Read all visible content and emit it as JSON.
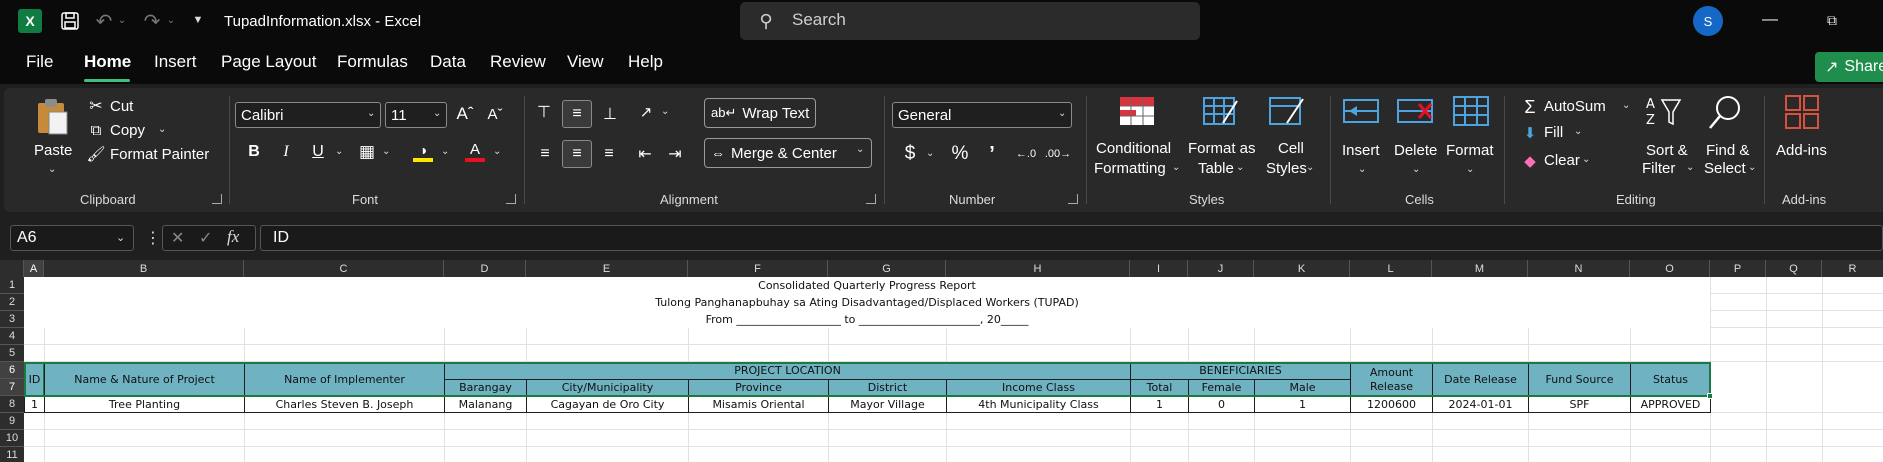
{
  "titlebar": {
    "app_logo": "X",
    "doc_title": "TupadInformation.xlsx  -  Excel",
    "search_placeholder": "Search",
    "avatar_initial": "S",
    "icons": [
      "excel-logo",
      "save-icon",
      "undo-icon",
      "redo-icon",
      "search-icon",
      "minimize-icon",
      "restore-icon"
    ]
  },
  "menu": {
    "tabs": [
      "File",
      "Home",
      "Insert",
      "Page Layout",
      "Formulas",
      "Data",
      "Review",
      "View",
      "Help"
    ],
    "active": "Home",
    "share_label": "Share"
  },
  "ribbon": {
    "clipboard": {
      "paste": "Paste",
      "cut": "Cut",
      "copy": "Copy",
      "format_painter": "Format Painter",
      "label": "Clipboard"
    },
    "font": {
      "name": "Calibri",
      "size": "11",
      "bold": "B",
      "italic": "I",
      "underline": "U",
      "label": "Font"
    },
    "alignment": {
      "wrap_text": "Wrap Text",
      "merge_center": "Merge & Center",
      "label": "Alignment"
    },
    "number": {
      "format": "General",
      "currency": "$",
      "percent": "%",
      "comma": "’",
      "label": "Number"
    },
    "styles": {
      "conditional_formatting_1": "Conditional",
      "conditional_formatting_2": "Formatting",
      "format_as_table_1": "Format as",
      "format_as_table_2": "Table",
      "cell_styles_1": "Cell",
      "cell_styles_2": "Styles",
      "label": "Styles"
    },
    "cells": {
      "insert": "Insert",
      "delete": "Delete",
      "format": "Format",
      "label": "Cells"
    },
    "editing": {
      "autosum": "AutoSum",
      "fill": "Fill",
      "clear": "Clear",
      "sort_filter_1": "Sort &",
      "sort_filter_2": "Filter",
      "find_select_1": "Find &",
      "find_select_2": "Select",
      "label": "Editing"
    },
    "addins": {
      "addins": "Add-ins",
      "label": "Add-ins"
    },
    "colors": {
      "highlight": "#ffe600",
      "font_color": "#e81123",
      "accent": "#3fbf7f"
    }
  },
  "formula_bar": {
    "name_box": "A6",
    "fx": "fx",
    "value": "ID"
  },
  "grid": {
    "columns": [
      "A",
      "B",
      "C",
      "D",
      "E",
      "F",
      "G",
      "H",
      "I",
      "J",
      "K",
      "L",
      "M",
      "N",
      "O",
      "P",
      "Q",
      "R"
    ],
    "rows": [
      "1",
      "2",
      "3",
      "4",
      "5",
      "6",
      "7",
      "8",
      "9",
      "10",
      "11"
    ],
    "selected_cell": "A6",
    "header_fill": "#6fb3c2",
    "report": {
      "title": "Consolidated Quarterly Progress Report",
      "subtitle": "Tulong Panghanapbuhay sa Ating Disadvantaged/Displaced Workers (TUPAD)",
      "period": "From ___________________ to ______________________, 20_____"
    },
    "headers": {
      "id": "ID",
      "name_nature": "Name & Nature of Project",
      "implementer": "Name of Implementer",
      "project_location": "PROJECT LOCATION",
      "barangay": "Barangay",
      "city": "City/Municipality",
      "province": "Province",
      "district": "District",
      "income_class": "Income Class",
      "beneficiaries": "BENEFICIARIES",
      "total": "Total",
      "female": "Female",
      "male": "Male",
      "amount_1": "Amount",
      "amount_2": "Release",
      "date_release": "Date Release",
      "fund_source": "Fund Source",
      "status": "Status"
    },
    "record": {
      "id": "1",
      "name_nature": "Tree Planting",
      "implementer": "Charles Steven B. Joseph",
      "barangay": "Malanang",
      "city": "Cagayan de Oro City",
      "province": "Misamis Oriental",
      "district": "Mayor Village",
      "income_class": "4th Municipality Class",
      "total": "1",
      "female": "0",
      "male": "1",
      "amount": "1200600",
      "date_release": "2024-01-01",
      "fund_source": "SPF",
      "status": "APPROVED"
    }
  }
}
